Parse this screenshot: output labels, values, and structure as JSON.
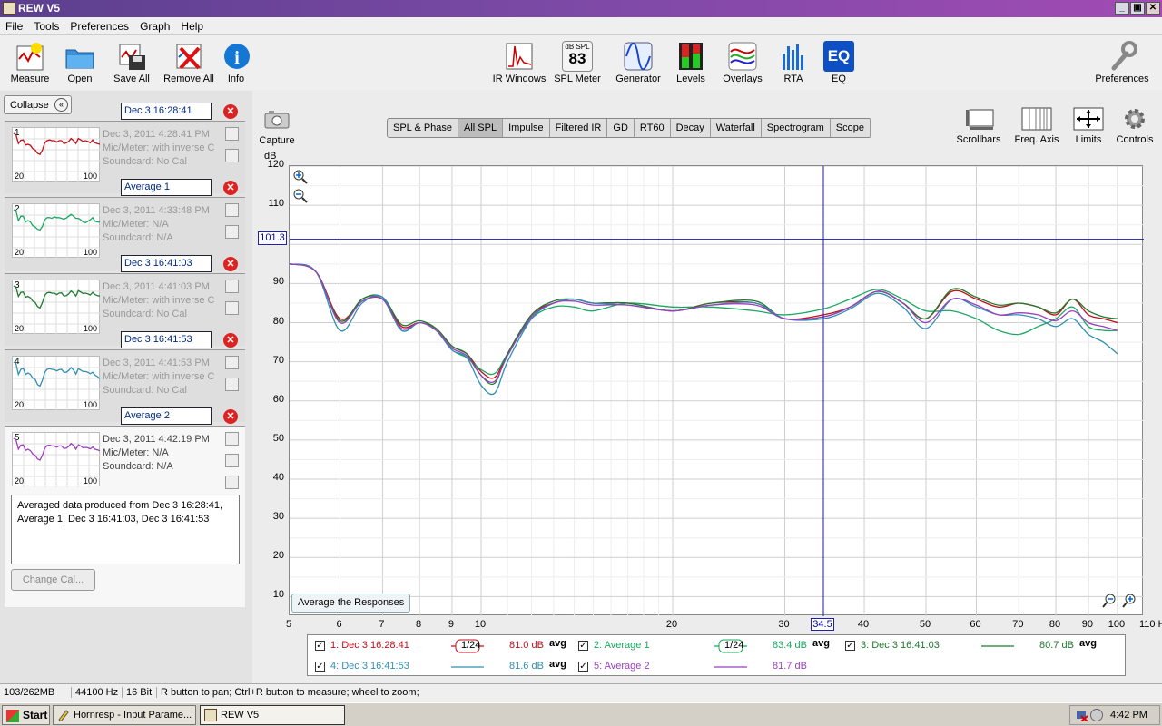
{
  "app": {
    "title": "REW V5"
  },
  "window_controls": [
    "_",
    "▣",
    "✕"
  ],
  "menu": [
    "File",
    "Tools",
    "Preferences",
    "Graph",
    "Help"
  ],
  "toolbar": {
    "measure": "Measure",
    "open": "Open",
    "save_all": "Save All",
    "remove_all": "Remove All",
    "info": "Info",
    "ir_windows": "IR Windows",
    "spl_meter": "SPL Meter",
    "spl_meter_badge": "dB SPL",
    "spl_meter_value": "83",
    "generator": "Generator",
    "levels": "Levels",
    "overlays": "Overlays",
    "rta": "RTA",
    "eq": "EQ",
    "eq_badge": "EQ",
    "preferences": "Preferences"
  },
  "left_panel": {
    "collapse_label": "Collapse",
    "collapse_icon": "«",
    "measurements": [
      {
        "num": "1",
        "name": "Dec 3 16:28:41",
        "date": "Dec 3, 2011 4:28:41 PM",
        "mic": "Mic/Meter: with inverse C",
        "soundcard": "Soundcard: No Cal",
        "color": "#c0101a",
        "axis_lo": "20",
        "axis_hi": "100"
      },
      {
        "num": "2",
        "name": "Average 1",
        "date": "Dec 3, 2011 4:33:48 PM",
        "mic": "Mic/Meter: N/A",
        "soundcard": "Soundcard: N/A",
        "color": "#1aa862",
        "axis_lo": "20",
        "axis_hi": "100"
      },
      {
        "num": "3",
        "name": "Dec 3 16:41:03",
        "date": "Dec 3, 2011 4:41:03 PM",
        "mic": "Mic/Meter: with inverse C",
        "soundcard": "Soundcard: No Cal",
        "color": "#1e7a2e",
        "axis_lo": "20",
        "axis_hi": "100"
      },
      {
        "num": "4",
        "name": "Dec 3 16:41:53",
        "date": "Dec 3, 2011 4:41:53 PM",
        "mic": "Mic/Meter: with inverse C",
        "soundcard": "Soundcard: No Cal",
        "color": "#2f8fb0",
        "axis_lo": "20",
        "axis_hi": "100"
      },
      {
        "num": "5",
        "name": "Average 2",
        "date": "Dec 3, 2011 4:42:19 PM",
        "mic": "Mic/Meter: N/A",
        "soundcard": "Soundcard: N/A",
        "color": "#9b3fc0",
        "axis_lo": "20",
        "axis_hi": "100"
      }
    ],
    "notes": "Averaged data produced from Dec 3 16:28:41, Average 1, Dec 3 16:41:03, Dec 3 16:41:53",
    "change_cal": "Change Cal..."
  },
  "capture": "Capture",
  "graph_tabs": [
    {
      "label": "SPL & Phase",
      "active": false
    },
    {
      "label": "All SPL",
      "active": true
    },
    {
      "label": "Impulse",
      "active": false
    },
    {
      "label": "Filtered IR",
      "active": false
    },
    {
      "label": "GD",
      "active": false
    },
    {
      "label": "RT60",
      "active": false
    },
    {
      "label": "Decay",
      "active": false
    },
    {
      "label": "Waterfall",
      "active": false
    },
    {
      "label": "Spectrogram",
      "active": false
    },
    {
      "label": "Scope",
      "active": false
    }
  ],
  "graph_controls": {
    "scrollbars": "Scrollbars",
    "freq_axis": "Freq. Axis",
    "limits": "Limits",
    "controls": "Controls"
  },
  "plot": {
    "y_unit": "dB",
    "y_ticks": [
      "120",
      "110",
      "100",
      "90",
      "80",
      "70",
      "60",
      "50",
      "40",
      "30",
      "20",
      "10"
    ],
    "x_ticks": [
      "5",
      "6",
      "7",
      "8",
      "9",
      "10",
      "20",
      "30",
      "40",
      "50",
      "60",
      "70",
      "80",
      "90",
      "100",
      "110 Hz"
    ],
    "cursor_y": "101.3",
    "cursor_x": "34.5",
    "average_button": "Average the Responses"
  },
  "chart_data": {
    "type": "line",
    "xlabel": "Hz",
    "ylabel": "dB",
    "xscale": "log",
    "xlim": [
      5,
      110
    ],
    "ylim": [
      5,
      120
    ],
    "grid": true,
    "cursor": {
      "x": 34.5,
      "y": 101.3
    },
    "x": [
      5,
      5.5,
      6,
      6.5,
      7,
      7.5,
      8,
      8.5,
      9,
      9.5,
      10,
      10.5,
      11,
      12,
      13,
      14,
      15,
      17,
      20,
      23,
      27,
      30,
      34.5,
      38,
      42,
      46,
      50,
      55,
      60,
      65,
      70,
      75,
      80,
      85,
      90,
      95,
      100
    ],
    "series": [
      {
        "name": "1: Dec 3 16:28:41",
        "color": "#c0101a",
        "values": [
          95,
          93,
          81,
          85.5,
          86,
          79,
          80,
          78.5,
          74,
          72,
          67.5,
          66,
          72,
          82,
          85,
          86,
          85,
          85,
          83,
          85,
          85,
          81,
          82,
          84,
          88,
          85,
          81,
          88,
          86,
          84,
          85,
          84,
          82,
          86,
          82,
          81,
          80
        ]
      },
      {
        "name": "2: Average 1",
        "color": "#1aa862",
        "values": [
          95,
          93,
          80,
          86,
          86,
          78,
          80,
          78,
          73,
          71,
          68,
          67,
          72,
          81,
          84,
          84,
          83,
          85,
          84,
          84,
          83,
          82,
          83.5,
          86,
          88.5,
          86,
          83,
          83,
          81,
          78,
          77,
          79,
          81,
          84,
          79,
          78,
          78
        ]
      },
      {
        "name": "3: Dec 3 16:41:03",
        "color": "#1e7a2e",
        "values": [
          95,
          93,
          80.5,
          86,
          86.5,
          79.5,
          80.5,
          78.5,
          74,
          72,
          66.5,
          64.5,
          72,
          82,
          85.5,
          86,
          85,
          85,
          83,
          85,
          85.5,
          81,
          81.5,
          84,
          88,
          85,
          81,
          88.5,
          86.5,
          84.5,
          85,
          84,
          82.5,
          86,
          83,
          81.5,
          81
        ]
      },
      {
        "name": "4: Dec 3 16:41:53",
        "color": "#2f8fb0",
        "values": [
          95,
          93,
          78,
          85,
          86.5,
          78,
          80,
          78,
          73,
          71,
          64,
          62,
          70,
          81,
          85,
          86,
          85,
          84.5,
          83,
          84.5,
          85,
          81,
          81,
          83.5,
          87.5,
          84,
          78.5,
          86,
          84,
          82,
          82,
          81,
          79,
          81,
          77,
          75,
          72
        ]
      },
      {
        "name": "5: Average 2",
        "color": "#9b3fc0",
        "values": [
          95,
          93,
          80,
          85.5,
          86,
          78.5,
          80,
          78,
          73.5,
          71.5,
          66.5,
          65,
          71.5,
          81.5,
          85,
          85.5,
          84.5,
          84.5,
          83,
          84.5,
          84.5,
          81,
          81.5,
          84,
          88,
          85,
          80,
          86,
          84.5,
          82,
          82.5,
          82,
          80.5,
          83,
          80,
          79,
          78
        ]
      }
    ]
  },
  "legend": [
    {
      "label": "1: Dec 3 16:28:41",
      "color": "#c0101a",
      "smoothing": "1/24",
      "avg": "81.0 dB",
      "avg_suffix": "avg"
    },
    {
      "label": "2: Average 1",
      "color": "#1aa862",
      "smoothing": "1/24",
      "avg": "83.4 dB",
      "avg_suffix": "avg"
    },
    {
      "label": "3: Dec 3 16:41:03",
      "color": "#1e7a2e",
      "smoothing": "",
      "avg": "80.7 dB",
      "avg_suffix": "avg"
    },
    {
      "label": "4: Dec 3 16:41:53",
      "color": "#2f8fb0",
      "smoothing": "",
      "avg": "81.6 dB",
      "avg_suffix": "avg"
    },
    {
      "label": "5: Average 2",
      "color": "#9b3fc0",
      "smoothing": "",
      "avg": "81.7 dB",
      "avg_suffix": ""
    }
  ],
  "legend_check": "✓",
  "status": {
    "memory": "103/262MB",
    "rate": "44100 Hz",
    "bits": "16 Bit",
    "hint": "R button to pan; Ctrl+R button to measure; wheel to zoom;"
  },
  "taskbar": {
    "start": "Start",
    "tasks": [
      "Hornresp - Input Parame...",
      "REW V5"
    ],
    "clock": "4:42 PM"
  }
}
